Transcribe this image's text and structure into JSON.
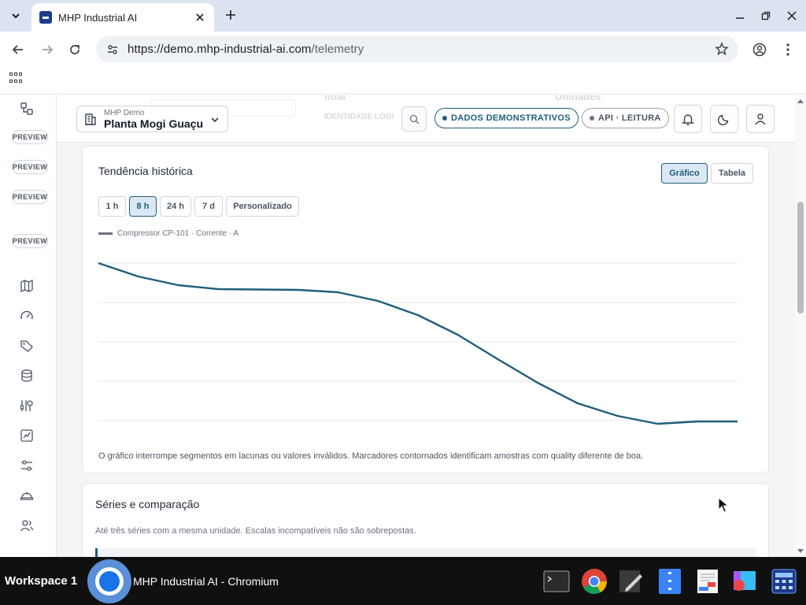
{
  "browser": {
    "tab_title": "MHP Industrial AI",
    "url_host": "https://demo.mhp-industrial-ai.com",
    "url_path": "/telemetry"
  },
  "sidebar": {
    "preview_badges": [
      "PREVIEW",
      "PREVIEW",
      "PREVIEW",
      "PREVIEW"
    ],
    "icons": [
      "map-icon",
      "gauge-icon",
      "tag-icon",
      "database-icon",
      "sensor-icon",
      "report-icon",
      "sliders-icon",
      "helmet-icon",
      "users-icon"
    ]
  },
  "header": {
    "ghost_text_1": "float",
    "ghost_text_2": "IDENTIDADE LÓGI",
    "ghost_text_3": "Unidades",
    "plant_small": "MHP Demo",
    "plant_name": "Planta Mogi Guaçu",
    "demo_pill": "DADOS DEMONSTRATIVOS",
    "api_pill": "API · LEITURA"
  },
  "history": {
    "title": "Tendência histórica",
    "view_buttons": [
      "Gráfico",
      "Tabela"
    ],
    "active_view": "Gráfico",
    "ranges": [
      "1 h",
      "8 h",
      "24 h",
      "7 d",
      "Personalizado"
    ],
    "active_range": "8 h",
    "legend": "Compressor CP-101 · Corrente · A",
    "note": "O gráfico interrompe segmentos em lacunas ou valores inválidos. Marcadores contornados identificam amostras com quality diferente de boa."
  },
  "chart_data": {
    "type": "line",
    "title": "",
    "xlabel": "",
    "ylabel": "",
    "grid": true,
    "series": [
      {
        "name": "Compressor CP-101 · Corrente · A",
        "color": "#1e5f7a",
        "values": [
          4.0,
          3.66,
          3.44,
          3.34,
          3.33,
          3.32,
          3.26,
          3.04,
          2.68,
          2.18,
          1.56,
          0.96,
          0.44,
          0.12,
          -0.08,
          -0.02,
          -0.02
        ]
      }
    ],
    "ylim": [
      0,
      4
    ],
    "gridlines": 5
  },
  "series": {
    "title": "Séries e comparação",
    "subtitle": "Até três séries com a mesma unidade. Escalas incompatíveis não são sobrepostas."
  },
  "taskbar": {
    "workspace": "Workspace 1",
    "window_title": "MHP Industrial AI - Chromium"
  }
}
